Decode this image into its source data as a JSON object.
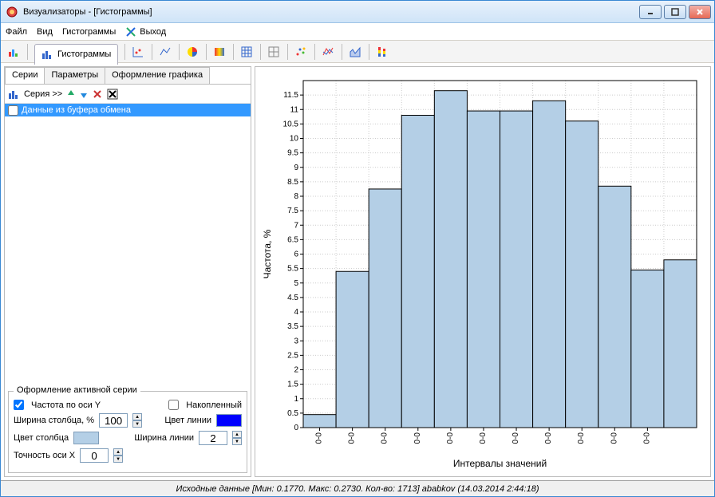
{
  "window": {
    "title": "Визуализаторы - [Гистограммы]"
  },
  "menu": {
    "file": "Файл",
    "view": "Вид",
    "hist": "Гистограммы",
    "exit": "Выход"
  },
  "tooltab": "Гистограммы",
  "subtabs": {
    "series": "Серии",
    "params": "Параметры",
    "style": "Оформление графика"
  },
  "series_bar": {
    "label": "Серия >>"
  },
  "series_item": "Данные из буфера обмена",
  "group": {
    "legend": "Оформление активной серии",
    "freq_y": "Частота по оси Y",
    "accum": "Накопленный",
    "col_width": "Ширина столбца, %",
    "col_width_val": "100",
    "col_color": "Цвет столбца",
    "line_color": "Цвет линии",
    "line_width": "Ширина линии",
    "line_width_val": "2",
    "x_prec": "Точность оси X",
    "x_prec_val": "0"
  },
  "colors": {
    "bar": "#b4cfe6",
    "line": "#0000ff"
  },
  "status": "Исходные данные [Мин: 0.1770. Макс: 0.2730. Кол-во: 1713] ababkov (14.03.2014 2:44:18)",
  "chart_data": {
    "type": "bar",
    "title": "",
    "xlabel": "Интервалы значений",
    "ylabel": "Частота, %",
    "ylim": [
      0,
      12
    ],
    "yticks": [
      0,
      0.5,
      1,
      1.5,
      2,
      2.5,
      3,
      3.5,
      4,
      4.5,
      5,
      5.5,
      6,
      6.5,
      7,
      7.5,
      8,
      8.5,
      9,
      9.5,
      10,
      10.5,
      11,
      11.5
    ],
    "categories": [
      "0-0",
      "0-0",
      "0-0",
      "0-0",
      "0-0",
      "0-0",
      "0-0",
      "0-0",
      "0-0",
      "0-0",
      "0-0"
    ],
    "values": [
      0.45,
      5.4,
      8.25,
      10.8,
      11.65,
      10.95,
      10.95,
      11.3,
      10.6,
      8.35,
      5.45,
      5.8
    ]
  }
}
